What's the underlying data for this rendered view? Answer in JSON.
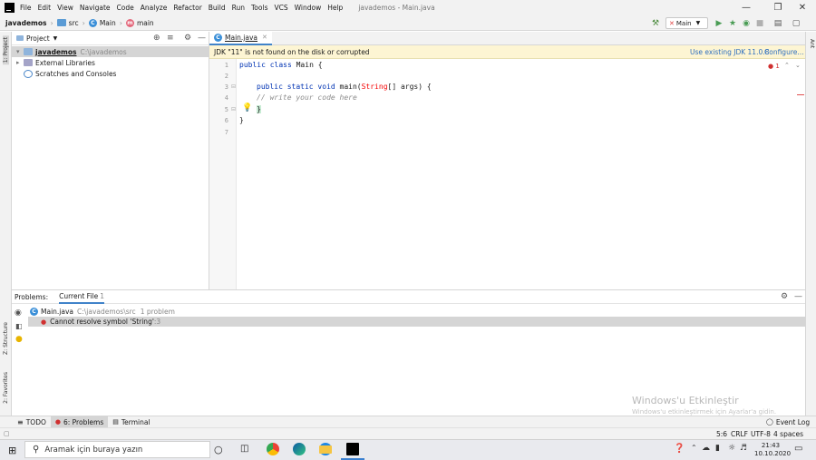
{
  "menu": {
    "items": [
      "File",
      "Edit",
      "View",
      "Navigate",
      "Code",
      "Analyze",
      "Refactor",
      "Build",
      "Run",
      "Tools",
      "VCS",
      "Window",
      "Help"
    ],
    "window_title": "javademos - Main.java"
  },
  "navbar": {
    "project": "javademos",
    "folder": "src",
    "class": "Main",
    "method": "main",
    "run_config": "Main"
  },
  "project_panel": {
    "title": "Project",
    "root_name": "javademos",
    "root_path": "C:\\javademos",
    "external_libraries": "External Libraries",
    "scratches": "Scratches and Consoles"
  },
  "side_tabs": {
    "project": "1: Project",
    "structure": "Z: Structure",
    "favorites": "2: Favorites",
    "ant": "Ant"
  },
  "editor": {
    "tab": "Main.java",
    "banner_text": "JDK \"11\" is not found on the disk or corrupted",
    "banner_use": "Use existing JDK 11.0.8",
    "banner_configure": "Configure...",
    "error_count": "1",
    "line_numbers": [
      "1",
      "2",
      "3",
      "4",
      "5",
      "6",
      "7"
    ],
    "line1": {
      "kw": "public class",
      "rest": " Main {"
    },
    "line3": {
      "kw": "public static void",
      "mid": " main(",
      "err": "String",
      "rest": "[] args) {"
    },
    "line4": "// write your code here",
    "line5": "}",
    "line6": "}"
  },
  "problems": {
    "label": "Problems:",
    "tab": "Current File",
    "tab_count": "1",
    "file_name": "Main.java",
    "file_path": "C:\\javademos\\src",
    "file_problems": "1 problem",
    "message": "Cannot resolve symbol 'String'",
    "message_line": ":3"
  },
  "tool_windows": {
    "todo": "TODO",
    "problems": "6: Problems",
    "terminal": "Terminal",
    "event_log": "Event Log"
  },
  "status": {
    "position": "5:6",
    "line_sep": "CRLF",
    "encoding": "UTF-8",
    "indent": "4 spaces"
  },
  "watermark": {
    "title": "Windows'u Etkinleştir",
    "subtitle": "Windows'u etkinleştirmek için Ayarlar'a gidin."
  },
  "taskbar": {
    "search_placeholder": "Aramak için buraya yazın",
    "time": "21:43",
    "date": "10.10.2020"
  }
}
